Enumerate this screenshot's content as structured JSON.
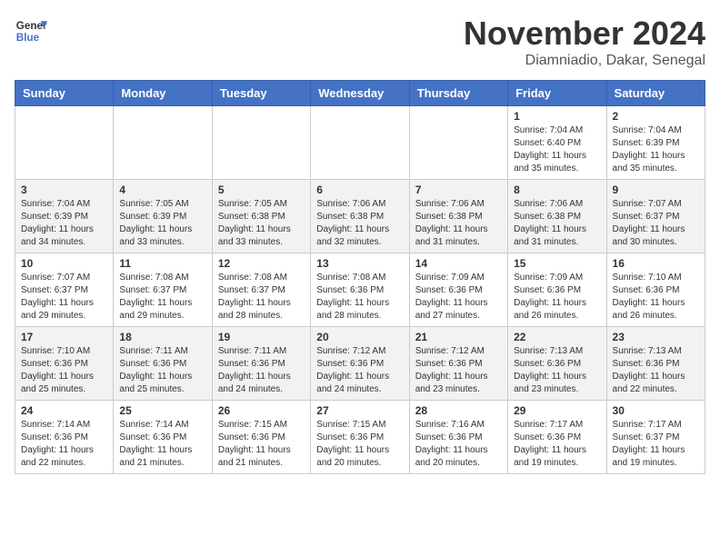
{
  "header": {
    "logo_line1": "General",
    "logo_line2": "Blue",
    "month": "November 2024",
    "location": "Diamniadio, Dakar, Senegal"
  },
  "weekdays": [
    "Sunday",
    "Monday",
    "Tuesday",
    "Wednesday",
    "Thursday",
    "Friday",
    "Saturday"
  ],
  "weeks": [
    [
      {
        "day": "",
        "info": ""
      },
      {
        "day": "",
        "info": ""
      },
      {
        "day": "",
        "info": ""
      },
      {
        "day": "",
        "info": ""
      },
      {
        "day": "",
        "info": ""
      },
      {
        "day": "1",
        "info": "Sunrise: 7:04 AM\nSunset: 6:40 PM\nDaylight: 11 hours and 35 minutes."
      },
      {
        "day": "2",
        "info": "Sunrise: 7:04 AM\nSunset: 6:39 PM\nDaylight: 11 hours and 35 minutes."
      }
    ],
    [
      {
        "day": "3",
        "info": "Sunrise: 7:04 AM\nSunset: 6:39 PM\nDaylight: 11 hours and 34 minutes."
      },
      {
        "day": "4",
        "info": "Sunrise: 7:05 AM\nSunset: 6:39 PM\nDaylight: 11 hours and 33 minutes."
      },
      {
        "day": "5",
        "info": "Sunrise: 7:05 AM\nSunset: 6:38 PM\nDaylight: 11 hours and 33 minutes."
      },
      {
        "day": "6",
        "info": "Sunrise: 7:06 AM\nSunset: 6:38 PM\nDaylight: 11 hours and 32 minutes."
      },
      {
        "day": "7",
        "info": "Sunrise: 7:06 AM\nSunset: 6:38 PM\nDaylight: 11 hours and 31 minutes."
      },
      {
        "day": "8",
        "info": "Sunrise: 7:06 AM\nSunset: 6:38 PM\nDaylight: 11 hours and 31 minutes."
      },
      {
        "day": "9",
        "info": "Sunrise: 7:07 AM\nSunset: 6:37 PM\nDaylight: 11 hours and 30 minutes."
      }
    ],
    [
      {
        "day": "10",
        "info": "Sunrise: 7:07 AM\nSunset: 6:37 PM\nDaylight: 11 hours and 29 minutes."
      },
      {
        "day": "11",
        "info": "Sunrise: 7:08 AM\nSunset: 6:37 PM\nDaylight: 11 hours and 29 minutes."
      },
      {
        "day": "12",
        "info": "Sunrise: 7:08 AM\nSunset: 6:37 PM\nDaylight: 11 hours and 28 minutes."
      },
      {
        "day": "13",
        "info": "Sunrise: 7:08 AM\nSunset: 6:36 PM\nDaylight: 11 hours and 28 minutes."
      },
      {
        "day": "14",
        "info": "Sunrise: 7:09 AM\nSunset: 6:36 PM\nDaylight: 11 hours and 27 minutes."
      },
      {
        "day": "15",
        "info": "Sunrise: 7:09 AM\nSunset: 6:36 PM\nDaylight: 11 hours and 26 minutes."
      },
      {
        "day": "16",
        "info": "Sunrise: 7:10 AM\nSunset: 6:36 PM\nDaylight: 11 hours and 26 minutes."
      }
    ],
    [
      {
        "day": "17",
        "info": "Sunrise: 7:10 AM\nSunset: 6:36 PM\nDaylight: 11 hours and 25 minutes."
      },
      {
        "day": "18",
        "info": "Sunrise: 7:11 AM\nSunset: 6:36 PM\nDaylight: 11 hours and 25 minutes."
      },
      {
        "day": "19",
        "info": "Sunrise: 7:11 AM\nSunset: 6:36 PM\nDaylight: 11 hours and 24 minutes."
      },
      {
        "day": "20",
        "info": "Sunrise: 7:12 AM\nSunset: 6:36 PM\nDaylight: 11 hours and 24 minutes."
      },
      {
        "day": "21",
        "info": "Sunrise: 7:12 AM\nSunset: 6:36 PM\nDaylight: 11 hours and 23 minutes."
      },
      {
        "day": "22",
        "info": "Sunrise: 7:13 AM\nSunset: 6:36 PM\nDaylight: 11 hours and 23 minutes."
      },
      {
        "day": "23",
        "info": "Sunrise: 7:13 AM\nSunset: 6:36 PM\nDaylight: 11 hours and 22 minutes."
      }
    ],
    [
      {
        "day": "24",
        "info": "Sunrise: 7:14 AM\nSunset: 6:36 PM\nDaylight: 11 hours and 22 minutes."
      },
      {
        "day": "25",
        "info": "Sunrise: 7:14 AM\nSunset: 6:36 PM\nDaylight: 11 hours and 21 minutes."
      },
      {
        "day": "26",
        "info": "Sunrise: 7:15 AM\nSunset: 6:36 PM\nDaylight: 11 hours and 21 minutes."
      },
      {
        "day": "27",
        "info": "Sunrise: 7:15 AM\nSunset: 6:36 PM\nDaylight: 11 hours and 20 minutes."
      },
      {
        "day": "28",
        "info": "Sunrise: 7:16 AM\nSunset: 6:36 PM\nDaylight: 11 hours and 20 minutes."
      },
      {
        "day": "29",
        "info": "Sunrise: 7:17 AM\nSunset: 6:36 PM\nDaylight: 11 hours and 19 minutes."
      },
      {
        "day": "30",
        "info": "Sunrise: 7:17 AM\nSunset: 6:37 PM\nDaylight: 11 hours and 19 minutes."
      }
    ]
  ]
}
